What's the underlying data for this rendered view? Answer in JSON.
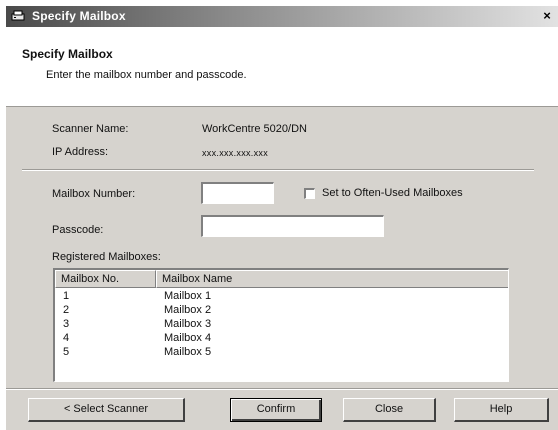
{
  "window": {
    "title": "Specify Mailbox",
    "close_glyph": "×"
  },
  "header": {
    "title": "Specify Mailbox",
    "subtitle": "Enter the mailbox number and passcode."
  },
  "info": {
    "scanner_name_label": "Scanner Name:",
    "scanner_name_value": "WorkCentre 5020/DN",
    "ip_address_label": "IP Address:",
    "ip_address_value": "xxx.xxx.xxx.xxx"
  },
  "form": {
    "mailbox_number_label": "Mailbox Number:",
    "mailbox_number_value": "",
    "often_used_label": "Set to Often-Used Mailboxes",
    "often_used_checked": false,
    "passcode_label": "Passcode:",
    "passcode_value": ""
  },
  "registered": {
    "label": "Registered Mailboxes:",
    "columns": [
      "Mailbox No.",
      "Mailbox Name"
    ],
    "rows": [
      {
        "no": "1",
        "name": "Mailbox 1"
      },
      {
        "no": "2",
        "name": "Mailbox 2"
      },
      {
        "no": "3",
        "name": "Mailbox 3"
      },
      {
        "no": "4",
        "name": "Mailbox 4"
      },
      {
        "no": "5",
        "name": "Mailbox 5"
      }
    ]
  },
  "buttons": {
    "select_scanner": "< Select Scanner",
    "confirm": "Confirm",
    "close": "Close",
    "help": "Help"
  },
  "colors": {
    "face": "#d6d3ce",
    "title_gradient_start": "#4a4a4a",
    "title_gradient_end": "#e2e2e2"
  }
}
